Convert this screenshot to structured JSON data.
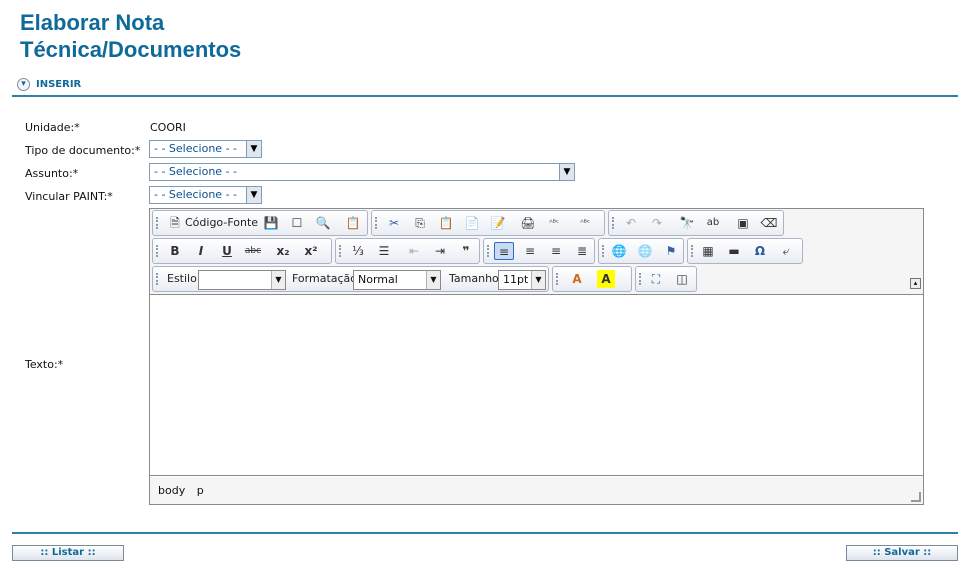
{
  "page": {
    "title_line1": "Elaborar Nota",
    "title_line2": "Técnica/Documentos"
  },
  "section": {
    "label": "INSERIR",
    "toggle_icon": "▾"
  },
  "form": {
    "unidade_label": "Unidade:*",
    "unidade_value": "COORI",
    "tipo_label": "Tipo de documento:*",
    "tipo_value": "- - Selecione - -",
    "assunto_label": "Assunto:*",
    "assunto_value": "- - Selecione - -",
    "paint_label": "Vincular PAINT:*",
    "paint_value": "- - Selecione - -",
    "texto_label": "Texto:*"
  },
  "editor": {
    "source_label": "Código-Fonte",
    "estilo_label": "Estilo",
    "estilo_value": "",
    "formatacao_label": "Formatação",
    "formatacao_value": "Normal",
    "tamanho_label": "Tamanho",
    "tamanho_value": "11pt",
    "path_body": "body",
    "path_p": "p",
    "icons": {
      "source": "🗎",
      "save": "💾",
      "newpage": "☐",
      "preview": "🔍",
      "templates": "📋",
      "cut": "✂",
      "copy": "⎘",
      "paste": "📋",
      "paste_text": "📄",
      "paste_word": "📝",
      "print": "🖨",
      "spell": "ᴬᴮᶜ",
      "scayt": "ᴬᴮᶜ",
      "undo": "↶",
      "redo": "↷",
      "find": "🔭",
      "replace": "ab",
      "selectall": "▣",
      "removeformat": "⌫",
      "bold": "B",
      "italic": "I",
      "underline": "U",
      "strike": "abc",
      "subscript": "x₂",
      "superscript": "x²",
      "ol": "⅓",
      "ul": "☰",
      "outdent": "⇤",
      "indent": "⇥",
      "blockquote": "❞",
      "align_left": "≡",
      "align_center": "≡",
      "align_right": "≡",
      "align_justify": "≣",
      "link": "🌐",
      "unlink": "🌐",
      "anchor": "⚑",
      "table": "▦",
      "hr": "▬",
      "specialchar": "Ω",
      "pagebreak": "⤶",
      "textcolor": "A",
      "bgcolor": "A",
      "maximize": "⛶",
      "showblocks": "◫",
      "collapse": "▴"
    }
  },
  "buttons": {
    "listar": ":: Listar ::",
    "salvar": ":: Salvar ::"
  },
  "colors": {
    "title": "#0f6a99",
    "accent_line": "#2f7fa7",
    "select_text": "#0d4f8b"
  }
}
